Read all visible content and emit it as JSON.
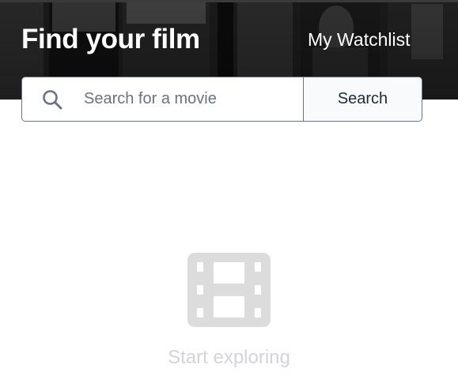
{
  "header": {
    "title": "Find your film",
    "watchlist_label": "My Watchlist"
  },
  "search": {
    "placeholder": "Search for a movie",
    "value": "",
    "button_label": "Search"
  },
  "empty_state": {
    "message": "Start exploring",
    "icon": "film-icon"
  },
  "colors": {
    "header_text": "#ffffff",
    "search_border": "#6b7280",
    "button_bg": "#f9fafb",
    "empty_icon": "#dcdcdc",
    "empty_text": "#d4d4d8"
  }
}
